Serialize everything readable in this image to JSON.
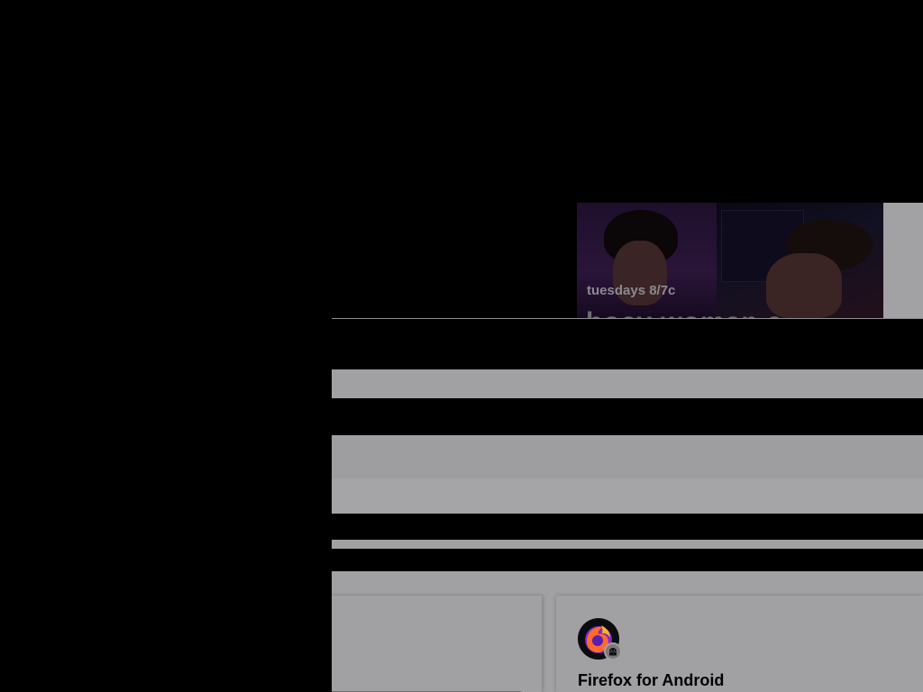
{
  "page": {
    "background": "#000000",
    "overlay_color": "#000000"
  },
  "promo": {
    "tagline": "tuesdays 8/7c",
    "show_title": "bocy woman a",
    "text_color": "#8b8a90"
  },
  "cards": {
    "right": {
      "title": "Firefox for Android",
      "icon": "firefox-android-logo-icon",
      "badge_icon": "android-icon"
    }
  },
  "colors": {
    "band_gray": "#a1a1a3",
    "firefox_orange": "#ff9500",
    "firefox_purple": "#592acb"
  }
}
